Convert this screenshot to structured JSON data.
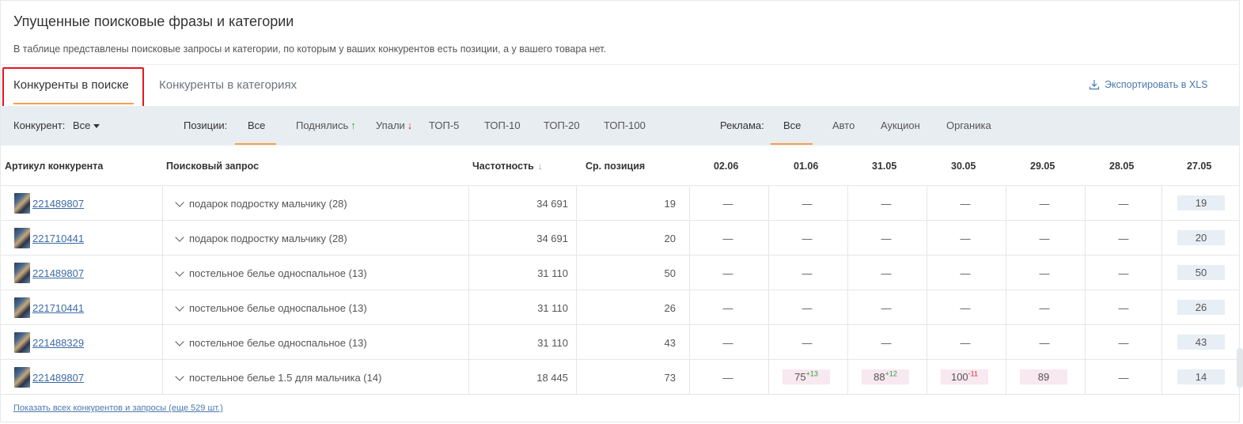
{
  "header": {
    "title": "Упущенные поисковые фразы и категории",
    "description": "В таблице представлены поисковые запросы и категории, по которым у ваших конкурентов есть позиции, а у вашего товара нет."
  },
  "tabs": [
    {
      "label": "Конкуренты в поиске",
      "active": true
    },
    {
      "label": "Конкуренты в категориях",
      "active": false
    }
  ],
  "export": {
    "label": "Экспортировать в XLS",
    "icon": "download-icon"
  },
  "filters": {
    "competitor_label": "Конкурент:",
    "competitor_value": "Все",
    "positions_label": "Позиции:",
    "positions": [
      "Все",
      "Поднялись",
      "Упали",
      "ТОП-5",
      "ТОП-10",
      "ТОП-20",
      "ТОП-100"
    ],
    "positions_active": "Все",
    "ads_label": "Реклама:",
    "ads": [
      "Все",
      "Авто",
      "Аукцион",
      "Органика"
    ],
    "ads_active": "Все"
  },
  "table": {
    "columns": [
      "Артикул конкурента",
      "Поисковый запрос",
      "Частотность",
      "Ср. позиция",
      "02.06",
      "01.06",
      "31.05",
      "30.05",
      "29.05",
      "28.05",
      "27.05"
    ],
    "rows": [
      {
        "article": "221489807",
        "query": "подарок подростку мальчику (28)",
        "frequency": "34 691",
        "avg": "19",
        "days": [
          {
            "v": "—"
          },
          {
            "v": "—"
          },
          {
            "v": "—"
          },
          {
            "v": "—"
          },
          {
            "v": "—"
          },
          {
            "v": "—"
          },
          {
            "v": "19",
            "style": "blue"
          }
        ]
      },
      {
        "article": "221710441",
        "query": "подарок подростку мальчику (28)",
        "frequency": "34 691",
        "avg": "20",
        "days": [
          {
            "v": "—"
          },
          {
            "v": "—"
          },
          {
            "v": "—"
          },
          {
            "v": "—"
          },
          {
            "v": "—"
          },
          {
            "v": "—"
          },
          {
            "v": "20",
            "style": "blue"
          }
        ]
      },
      {
        "article": "221489807",
        "query": "постельное белье односпальное (13)",
        "frequency": "31 110",
        "avg": "50",
        "days": [
          {
            "v": "—"
          },
          {
            "v": "—"
          },
          {
            "v": "—"
          },
          {
            "v": "—"
          },
          {
            "v": "—"
          },
          {
            "v": "—"
          },
          {
            "v": "50",
            "style": "blue"
          }
        ]
      },
      {
        "article": "221710441",
        "query": "постельное белье односпальное (13)",
        "frequency": "31 110",
        "avg": "26",
        "days": [
          {
            "v": "—"
          },
          {
            "v": "—"
          },
          {
            "v": "—"
          },
          {
            "v": "—"
          },
          {
            "v": "—"
          },
          {
            "v": "—"
          },
          {
            "v": "26",
            "style": "blue"
          }
        ]
      },
      {
        "article": "221488329",
        "query": "постельное белье односпальное (13)",
        "frequency": "31 110",
        "avg": "43",
        "days": [
          {
            "v": "—"
          },
          {
            "v": "—"
          },
          {
            "v": "—"
          },
          {
            "v": "—"
          },
          {
            "v": "—"
          },
          {
            "v": "—"
          },
          {
            "v": "43",
            "style": "blue"
          }
        ]
      },
      {
        "article": "221489807",
        "query": "постельное белье 1.5 для мальчика (14)",
        "frequency": "18 445",
        "avg": "73",
        "days": [
          {
            "v": "—"
          },
          {
            "v": "75",
            "delta": "+13",
            "style": "pink"
          },
          {
            "v": "88",
            "delta": "+12",
            "style": "pink"
          },
          {
            "v": "100",
            "delta": "-11",
            "style": "pink"
          },
          {
            "v": "89",
            "style": "pink"
          },
          {
            "v": "—"
          },
          {
            "v": "14",
            "style": "blue"
          }
        ]
      }
    ]
  },
  "footer": {
    "show_all": "Показать всех конкурентов и запросы (еще 529 шт.)"
  },
  "colors": {
    "accent": "#f5a04a",
    "highlight": "#e8161e",
    "link": "#3d6aa5",
    "filterbar": "#e8edf1"
  }
}
